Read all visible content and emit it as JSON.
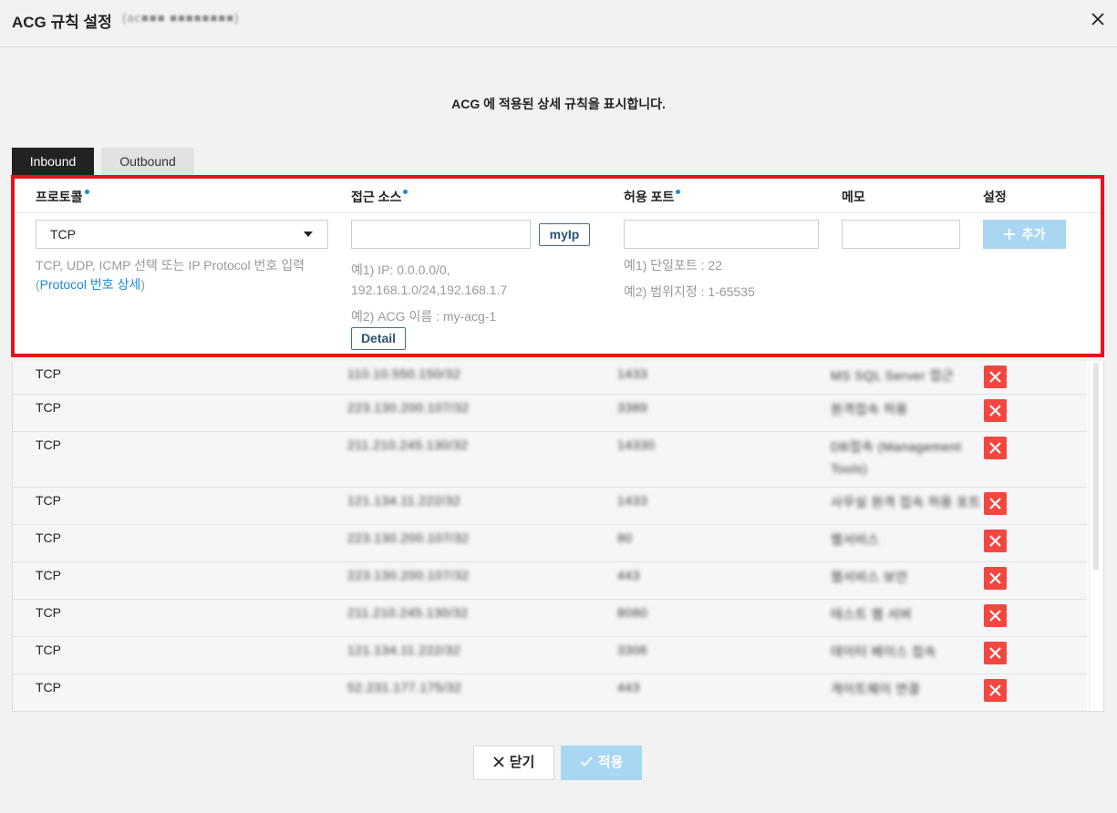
{
  "dialog": {
    "title": "ACG 규칙 설정",
    "subtitle": "(ac■■■ ■■■■■■■■)",
    "description": "ACG 에 적용된 상세 규칙을 표시합니다."
  },
  "tabs": [
    {
      "label": "Inbound",
      "active": true
    },
    {
      "label": "Outbound",
      "active": false
    }
  ],
  "form": {
    "headers": {
      "protocol": "프로토콜",
      "source": "접근 소스",
      "port": "허용 포트",
      "memo": "메모",
      "setting": "설정"
    },
    "protocol_select_value": "TCP",
    "protocol_hint": "TCP, UDP, ICMP 선택 또는 IP Protocol 번호 입력",
    "protocol_hint_open": "(",
    "protocol_link": "Protocol 번호 상세",
    "protocol_hint_close": ")",
    "myip_label": "myIp",
    "source_hint_1": "예1) IP: 0.0.0.0/0,",
    "source_hint_2": "192.168.1.0/24,192.168.1.7",
    "source_hint_3": "예2) ACG 이름 : my-acg-1",
    "detail_label": "Detail",
    "port_hint_1": "예1) 단일포트 : 22",
    "port_hint_2": "예2) 범위지정 : 1-65535",
    "add_label": "추가"
  },
  "rules": [
    {
      "protocol": "TCP",
      "source": "110.10.550.150/32",
      "port": "1433",
      "memo": "MS SQL Server 접근"
    },
    {
      "protocol": "TCP",
      "source": "223.130.200.107/32",
      "port": "3389",
      "memo": "원격접속 허용"
    },
    {
      "protocol": "TCP",
      "source": "211.210.245.130/32",
      "port": "14330",
      "memo": "DB접속 (Management",
      "memo2": "Tools)"
    },
    {
      "protocol": "TCP",
      "source": "121.134.11.222/32",
      "port": "1433",
      "memo": "사무실 원격 접속 허용 포트"
    },
    {
      "protocol": "TCP",
      "source": "223.130.200.107/32",
      "port": "80",
      "memo": "웹서비스"
    },
    {
      "protocol": "TCP",
      "source": "223.130.200.107/32",
      "port": "443",
      "memo": "웹서비스 보안"
    },
    {
      "protocol": "TCP",
      "source": "211.210.245.130/32",
      "port": "8080",
      "memo": "테스트 웹 서버"
    },
    {
      "protocol": "TCP",
      "source": "121.134.11.222/32",
      "port": "3306",
      "memo": "데이터 베이스 접속"
    },
    {
      "protocol": "TCP",
      "source": "52.231.177.175/32",
      "port": "443",
      "memo": "게이트웨이 연결"
    }
  ],
  "footer": {
    "close_label": "닫기",
    "apply_label": "적용"
  },
  "colors": {
    "accent_red_frame": "#e3141c",
    "primary_light_blue": "#a9d7f2",
    "delete_red": "#f2473f",
    "link_blue": "#1a8cd8",
    "tab_active_bg": "#222222"
  }
}
